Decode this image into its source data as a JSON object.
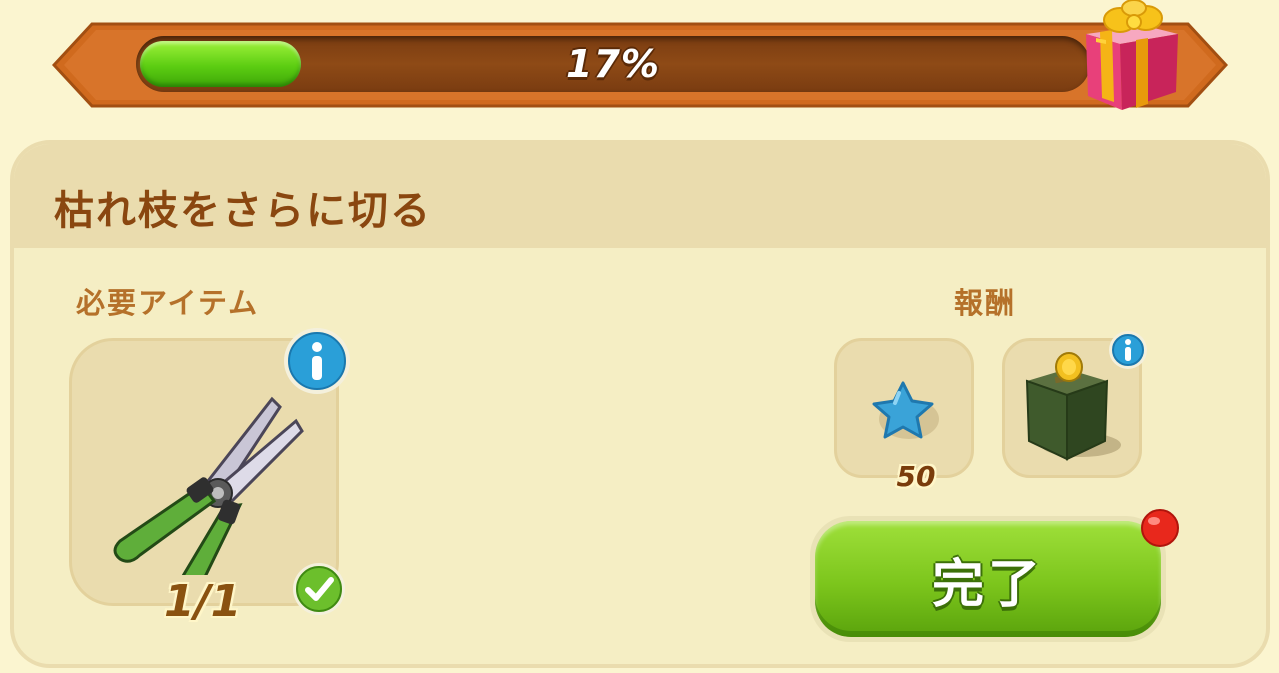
{
  "progress": {
    "value": 0.17,
    "label": "17%"
  },
  "task": {
    "title": "枯れ枝をさらに切る"
  },
  "requirements": {
    "label": "必要アイテム",
    "item": {
      "icon": "pruning-shears-icon",
      "count": "1/1",
      "status": "complete"
    }
  },
  "rewards": {
    "label": "報酬",
    "items": [
      {
        "icon": "blue-star-icon",
        "amount": "50"
      },
      {
        "icon": "green-coin-box-icon"
      }
    ]
  },
  "complete_button": {
    "label": "完了"
  },
  "colors": {
    "background": "#fbf5d0",
    "panel": "#f5eec4",
    "header": "#eadcae",
    "title": "#8a4710",
    "section_label": "#b5712a",
    "progress_fill": "#5ccd12",
    "button": "#7cc51c",
    "notification": "#e8281c",
    "info": "#2a9fd8"
  }
}
